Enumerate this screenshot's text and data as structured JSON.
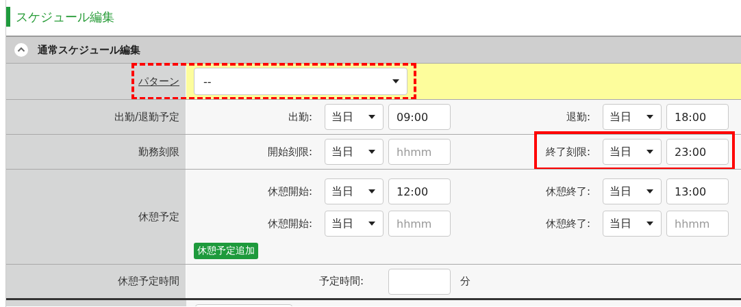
{
  "page_title": "スケジュール編集",
  "section": {
    "title": "通常スケジュール編集",
    "expanded": true
  },
  "rows": [
    {
      "kind": "pattern",
      "label": "パターン",
      "select": "--",
      "highlighted": true
    },
    {
      "kind": "pairs",
      "label": "出勤/退勤予定",
      "lines": [
        [
          {
            "label": "出勤:",
            "day": "当日",
            "time": {
              "value": "09:00"
            }
          },
          {
            "label": "退勤:",
            "day": "当日",
            "time": {
              "value": "18:00"
            }
          }
        ]
      ]
    },
    {
      "kind": "pairs",
      "label": "勤務刻限",
      "lines": [
        [
          {
            "label": "開始刻限:",
            "day": "当日",
            "time": {
              "placeholder": "hhmm"
            }
          },
          {
            "label": "終了刻限:",
            "day": "当日",
            "time": {
              "value": "23:00"
            },
            "highlighted": true
          }
        ]
      ]
    },
    {
      "kind": "pairs",
      "label": "休憩予定",
      "lines": [
        [
          {
            "label": "休憩開始:",
            "day": "当日",
            "time": {
              "value": "12:00"
            }
          },
          {
            "label": "休憩終了:",
            "day": "当日",
            "time": {
              "value": "13:00"
            }
          }
        ],
        [
          {
            "label": "休憩開始:",
            "day": "当日",
            "time": {
              "placeholder": "hhmm"
            }
          },
          {
            "label": "休憩終了:",
            "day": "当日",
            "time": {
              "placeholder": "hhmm"
            }
          }
        ]
      ],
      "add_button": "休憩予定追加"
    },
    {
      "kind": "duration",
      "label": "休憩予定時間",
      "field_label": "予定時間:",
      "unit": "分"
    }
  ]
}
